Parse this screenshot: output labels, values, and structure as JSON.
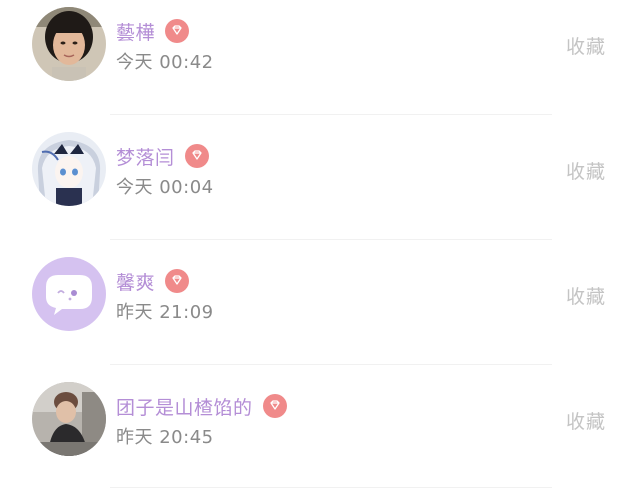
{
  "rows": [
    {
      "name": "藝樺",
      "time": "今天 00:42",
      "action": "收藏",
      "avatar": "photo-girl"
    },
    {
      "name": "梦落闫",
      "time": "今天 00:04",
      "action": "收藏",
      "avatar": "anime-girl"
    },
    {
      "name": "馨爽",
      "time": "昨天 21:09",
      "action": "收藏",
      "avatar": "default-chat"
    },
    {
      "name": "团子是山楂馅的",
      "time": "昨天 20:45",
      "action": "收藏",
      "avatar": "photo-street"
    }
  ],
  "colors": {
    "name": "#b48ed6",
    "vip_badge": "#f08a8a",
    "time": "#8a8a8a",
    "action": "#c4c4c4"
  },
  "icons": {
    "badge": "diamond-icon"
  }
}
